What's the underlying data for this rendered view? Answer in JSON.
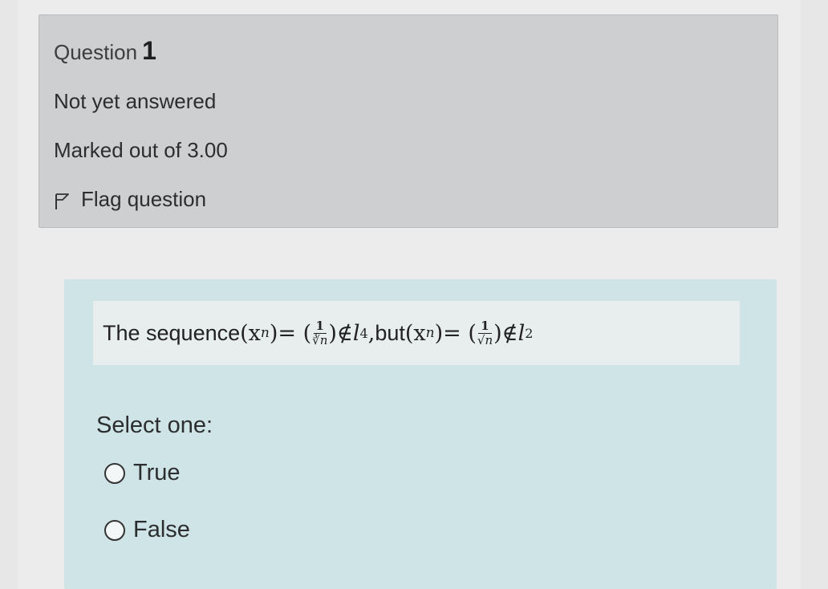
{
  "question": {
    "label": "Question",
    "number": "1",
    "state": "Not yet answered",
    "grade": "Marked out of 3.00",
    "flag_label": "Flag question",
    "flag_icon": "flag-icon"
  },
  "content": {
    "text_intro": "The sequence ",
    "text_but": " but ",
    "math": {
      "lhs1": "(x",
      "sub_n": "n",
      "rhs_paren_close": ")",
      "equals": " = (",
      "frac1_num": "1",
      "frac1_den": "∛n",
      "close_paren": ")",
      "notin": " ∉ ",
      "l": "l",
      "exp1": "4",
      "comma": ",",
      "frac2_num": "1",
      "frac2_den": "√n",
      "exp2": "2"
    },
    "select_label": "Select one:",
    "options": [
      {
        "label": "True"
      },
      {
        "label": "False"
      }
    ]
  },
  "colors": {
    "info_bg": "#cdcfd0",
    "content_bg": "#cfe4e6",
    "qtext_bg": "#e8eeee"
  }
}
